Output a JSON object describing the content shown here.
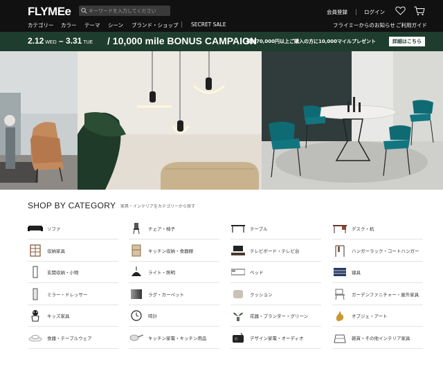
{
  "header": {
    "logo": "FLYMEe",
    "search_placeholder": "キーワードを入力してください",
    "register": "会員登録",
    "login": "ログイン",
    "nav": [
      "カテゴリー",
      "カラー",
      "テーマ",
      "シーン",
      "ブランド・ショップ"
    ],
    "secret_sale": "SECRET SALE",
    "news": "フライミーからのお知らせ",
    "guide": "ご利用ガイド"
  },
  "banner": {
    "date_start": "2.12",
    "date_start_day": "WED",
    "date_end": "3.31",
    "date_end_day": "TUE",
    "campaign": "10,000 mile BONUS CAMPAIGN",
    "description": "累計70,000円以上ご購入の方に10,000マイルプレゼント",
    "detail_button": "詳細はこちら"
  },
  "category": {
    "title": "SHOP BY CATEGORY",
    "subtitle": "家具・インテリアをカテゴリーから探す",
    "items": [
      {
        "label": "ソファ",
        "icon": "sofa-icon"
      },
      {
        "label": "チェア・椅子",
        "icon": "chair-icon"
      },
      {
        "label": "テーブル",
        "icon": "table-icon"
      },
      {
        "label": "デスク・机",
        "icon": "desk-icon"
      },
      {
        "label": "収納家具",
        "icon": "shelf-icon"
      },
      {
        "label": "キッチン収納・食器棚",
        "icon": "cupboard-icon"
      },
      {
        "label": "テレビボード・テレビ台",
        "icon": "tv-board-icon"
      },
      {
        "label": "ハンガーラック・コートハンガー",
        "icon": "hanger-rack-icon"
      },
      {
        "label": "玄関収納・小物",
        "icon": "entrance-storage-icon"
      },
      {
        "label": "ライト・照明",
        "icon": "lamp-icon"
      },
      {
        "label": "ベッド",
        "icon": "bed-icon"
      },
      {
        "label": "寝具",
        "icon": "bedding-icon"
      },
      {
        "label": "ミラー・ドレッサー",
        "icon": "mirror-icon"
      },
      {
        "label": "ラグ・カーペット",
        "icon": "rug-icon"
      },
      {
        "label": "クッション",
        "icon": "cushion-icon"
      },
      {
        "label": "ガーデンファニチャー・屋外家具",
        "icon": "garden-chair-icon"
      },
      {
        "label": "キッズ家具",
        "icon": "kids-icon"
      },
      {
        "label": "時計",
        "icon": "clock-icon"
      },
      {
        "label": "花器・プランター・グリーン",
        "icon": "plant-icon"
      },
      {
        "label": "オブジェ・アート",
        "icon": "object-icon"
      },
      {
        "label": "食器・テーブルウェア",
        "icon": "tableware-icon"
      },
      {
        "label": "キッチン家電・キッチン用品",
        "icon": "pan-icon"
      },
      {
        "label": "デザイン家電・オーディオ",
        "icon": "radio-icon"
      },
      {
        "label": "雑貨・その他インテリア家具",
        "icon": "goods-icon"
      }
    ]
  },
  "colors": {
    "header_bg": "#111111",
    "banner_bg": "#1e3d2e",
    "teal_chair": "#0f6b73"
  }
}
